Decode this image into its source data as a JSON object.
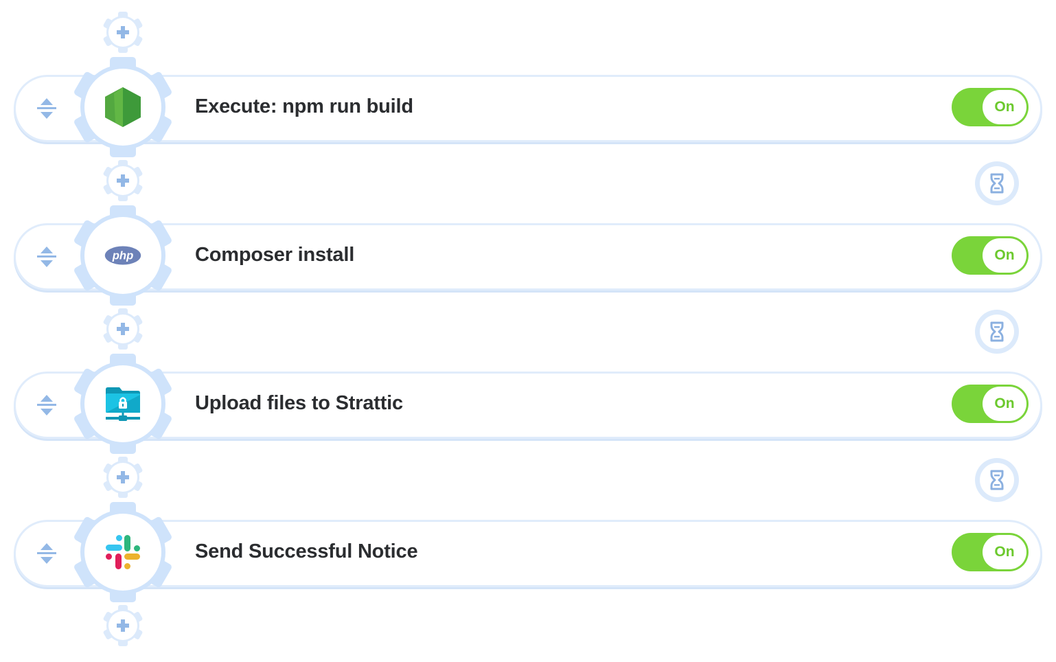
{
  "pipeline": {
    "add_step_label": "+",
    "steps": [
      {
        "title": "Execute: npm run build",
        "icon": "nodejs-icon",
        "toggle": "On",
        "enabled": true
      },
      {
        "title": "Composer install",
        "icon": "php-icon",
        "toggle": "On",
        "enabled": true
      },
      {
        "title": "Upload files to Strattic",
        "icon": "sftp-folder-icon",
        "toggle": "On",
        "enabled": true
      },
      {
        "title": "Send Successful Notice",
        "icon": "slack-icon",
        "toggle": "On",
        "enabled": true
      }
    ],
    "php_logo_text": "php",
    "colors": {
      "gear_light": "#dceafb",
      "gear_mid": "#cfe3fb",
      "accent_blue": "#93b8e6",
      "toggle_green": "#7ad43a",
      "title_text": "#2b2d30"
    }
  }
}
